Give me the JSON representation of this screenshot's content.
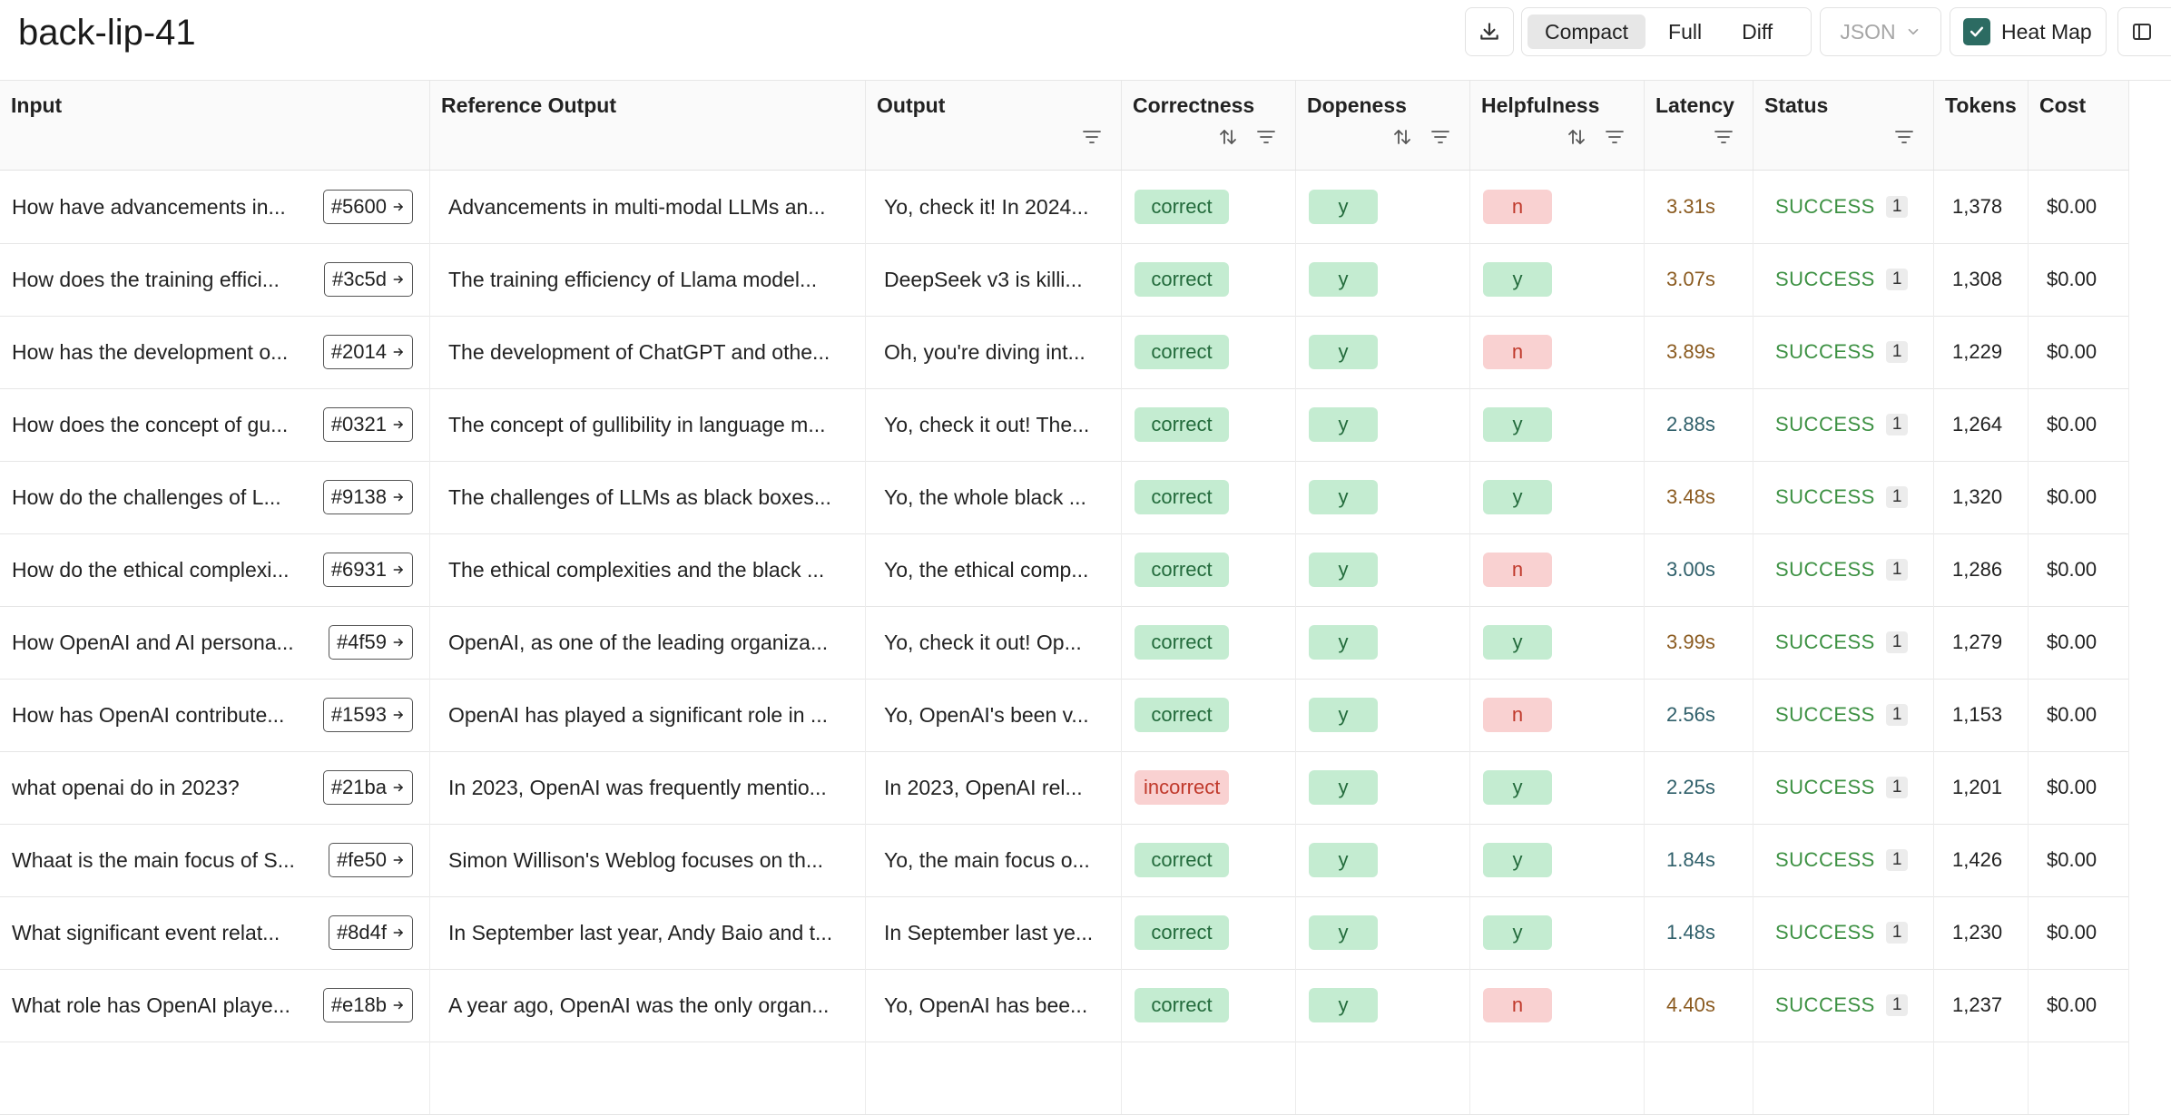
{
  "title": "back-lip-41",
  "toolbar": {
    "view_modes": [
      "Compact",
      "Full",
      "Diff"
    ],
    "active_mode": "Compact",
    "format_select": "JSON",
    "heat_map_label": "Heat Map",
    "heat_map_checked": true
  },
  "columns": [
    {
      "key": "input",
      "label": "Input",
      "sort": false,
      "filter": false
    },
    {
      "key": "reference",
      "label": "Reference Output",
      "sort": false,
      "filter": false
    },
    {
      "key": "output",
      "label": "Output",
      "sort": false,
      "filter": true
    },
    {
      "key": "correctness",
      "label": "Correctness",
      "sort": true,
      "filter": true
    },
    {
      "key": "dopeness",
      "label": "Dopeness",
      "sort": true,
      "filter": true
    },
    {
      "key": "helpfulness",
      "label": "Helpfulness",
      "sort": true,
      "filter": true
    },
    {
      "key": "latency",
      "label": "Latency",
      "sort": false,
      "filter": true
    },
    {
      "key": "status",
      "label": "Status",
      "sort": false,
      "filter": true
    },
    {
      "key": "tokens",
      "label": "Tokens",
      "sort": false,
      "filter": false
    },
    {
      "key": "cost",
      "label": "Cost",
      "sort": false,
      "filter": false
    }
  ],
  "colors": {
    "latency_slow": "#8a5a1f",
    "latency_fast": "#2f5f6a",
    "success": "#3d9143"
  },
  "rows": [
    {
      "input": "How have advancements in...",
      "id": "#5600",
      "reference": "Advancements in multi-modal LLMs an...",
      "output": "Yo, check it! In 2024...",
      "correctness": "correct",
      "dopeness": "y",
      "helpfulness": "n",
      "latency": "3.31s",
      "latency_slow": true,
      "status": "SUCCESS",
      "status_count": "1",
      "tokens": "1,378",
      "cost": "$0.00"
    },
    {
      "input": "How does the training effici...",
      "id": "#3c5d",
      "reference": "The training efficiency of Llama model...",
      "output": "DeepSeek v3 is killi...",
      "correctness": "correct",
      "dopeness": "y",
      "helpfulness": "y",
      "latency": "3.07s",
      "latency_slow": true,
      "status": "SUCCESS",
      "status_count": "1",
      "tokens": "1,308",
      "cost": "$0.00"
    },
    {
      "input": "How has the development o...",
      "id": "#2014",
      "reference": "The development of ChatGPT and othe...",
      "output": "Oh, you're diving int...",
      "correctness": "correct",
      "dopeness": "y",
      "helpfulness": "n",
      "latency": "3.89s",
      "latency_slow": true,
      "status": "SUCCESS",
      "status_count": "1",
      "tokens": "1,229",
      "cost": "$0.00"
    },
    {
      "input": "How does the concept of gu...",
      "id": "#0321",
      "reference": "The concept of gullibility in language m...",
      "output": "Yo, check it out! The...",
      "correctness": "correct",
      "dopeness": "y",
      "helpfulness": "y",
      "latency": "2.88s",
      "latency_slow": false,
      "status": "SUCCESS",
      "status_count": "1",
      "tokens": "1,264",
      "cost": "$0.00"
    },
    {
      "input": "How do the challenges of L...",
      "id": "#9138",
      "reference": "The challenges of LLMs as black boxes...",
      "output": "Yo, the whole black ...",
      "correctness": "correct",
      "dopeness": "y",
      "helpfulness": "y",
      "latency": "3.48s",
      "latency_slow": true,
      "status": "SUCCESS",
      "status_count": "1",
      "tokens": "1,320",
      "cost": "$0.00"
    },
    {
      "input": "How do the ethical complexi...",
      "id": "#6931",
      "reference": "The ethical complexities and the black ...",
      "output": "Yo, the ethical comp...",
      "correctness": "correct",
      "dopeness": "y",
      "helpfulness": "n",
      "latency": "3.00s",
      "latency_slow": false,
      "status": "SUCCESS",
      "status_count": "1",
      "tokens": "1,286",
      "cost": "$0.00"
    },
    {
      "input": "How OpenAI and AI persona...",
      "id": "#4f59",
      "reference": "OpenAI, as one of the leading organiza...",
      "output": "Yo, check it out! Op...",
      "correctness": "correct",
      "dopeness": "y",
      "helpfulness": "y",
      "latency": "3.99s",
      "latency_slow": true,
      "status": "SUCCESS",
      "status_count": "1",
      "tokens": "1,279",
      "cost": "$0.00"
    },
    {
      "input": "How has OpenAI contribute...",
      "id": "#1593",
      "reference": "OpenAI has played a significant role in ...",
      "output": "Yo, OpenAI's been v...",
      "correctness": "correct",
      "dopeness": "y",
      "helpfulness": "n",
      "latency": "2.56s",
      "latency_slow": false,
      "status": "SUCCESS",
      "status_count": "1",
      "tokens": "1,153",
      "cost": "$0.00"
    },
    {
      "input": "what openai do in 2023?",
      "id": "#21ba",
      "reference": "In 2023, OpenAI was frequently mentio...",
      "output": "In 2023, OpenAI rel...",
      "correctness": "incorrect",
      "dopeness": "y",
      "helpfulness": "y",
      "latency": "2.25s",
      "latency_slow": false,
      "status": "SUCCESS",
      "status_count": "1",
      "tokens": "1,201",
      "cost": "$0.00"
    },
    {
      "input": "Whaat is the main focus of S...",
      "id": "#fe50",
      "reference": "Simon Willison's Weblog focuses on th...",
      "output": "Yo, the main focus o...",
      "correctness": "correct",
      "dopeness": "y",
      "helpfulness": "y",
      "latency": "1.84s",
      "latency_slow": false,
      "status": "SUCCESS",
      "status_count": "1",
      "tokens": "1,426",
      "cost": "$0.00"
    },
    {
      "input": "What significant event relat...",
      "id": "#8d4f",
      "reference": "In September last year, Andy Baio and t...",
      "output": "In September last ye...",
      "correctness": "correct",
      "dopeness": "y",
      "helpfulness": "y",
      "latency": "1.48s",
      "latency_slow": false,
      "status": "SUCCESS",
      "status_count": "1",
      "tokens": "1,230",
      "cost": "$0.00"
    },
    {
      "input": "What role has OpenAI playe...",
      "id": "#e18b",
      "reference": "A year ago, OpenAI was the only organ...",
      "output": "Yo, OpenAI has bee...",
      "correctness": "correct",
      "dopeness": "y",
      "helpfulness": "n",
      "latency": "4.40s",
      "latency_slow": true,
      "status": "SUCCESS",
      "status_count": "1",
      "tokens": "1,237",
      "cost": "$0.00"
    }
  ]
}
